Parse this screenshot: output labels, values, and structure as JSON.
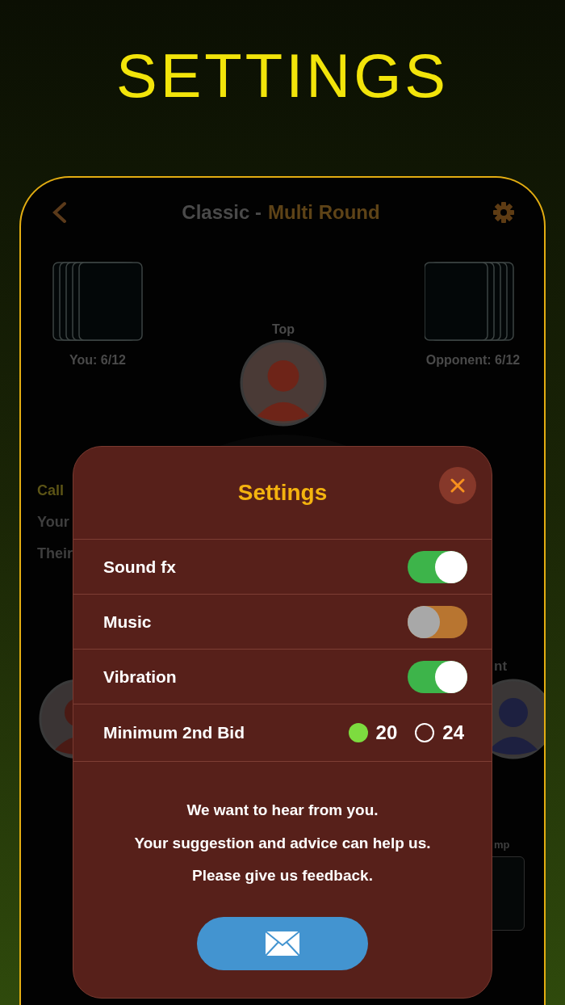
{
  "page_heading": "SETTINGS",
  "game": {
    "title": "Classic -",
    "mode": "Multi Round",
    "you": "You: 6/12",
    "top": "Top",
    "opponent": "Opponent: 6/12",
    "side_labels": [
      {
        "text": "Call",
        "kind": "heading"
      },
      {
        "text": "Your",
        "kind": "plain"
      },
      {
        "text": "Their",
        "kind": "plain"
      }
    ],
    "right_labels": [
      "nt",
      "mp"
    ]
  },
  "settings": {
    "title": "Settings",
    "toggles": [
      {
        "label": "Sound fx",
        "on": true
      },
      {
        "label": "Music",
        "on": false
      },
      {
        "label": "Vibration",
        "on": true
      }
    ],
    "bid": {
      "label": "Minimum 2nd Bid",
      "options": [
        {
          "label": "20",
          "selected": true
        },
        {
          "label": "24",
          "selected": false
        }
      ]
    },
    "message": [
      "We want to hear from you.",
      "Your suggestion and advice can help us.",
      "Please give us feedback."
    ]
  }
}
